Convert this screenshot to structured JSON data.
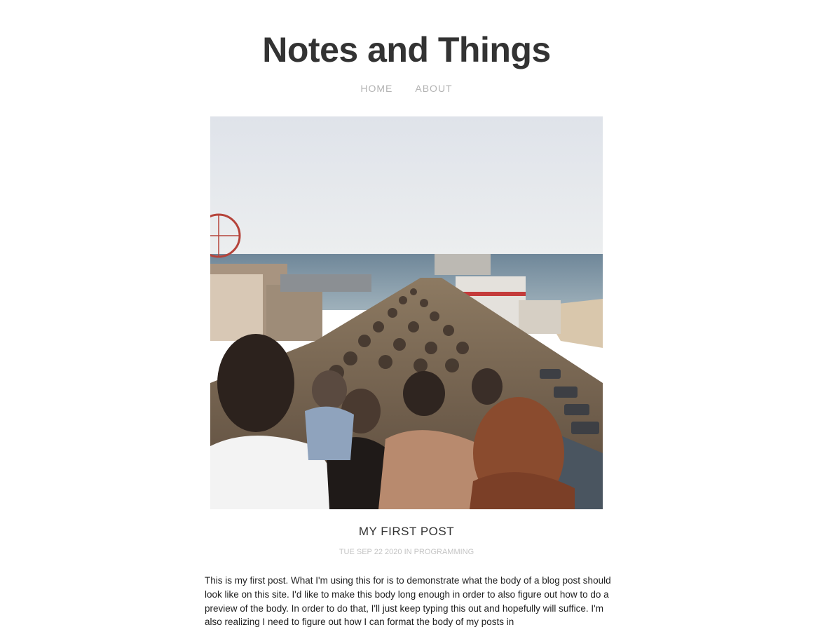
{
  "site": {
    "title": "Notes and Things"
  },
  "nav": {
    "items": [
      {
        "label": "HOME"
      },
      {
        "label": "ABOUT"
      }
    ]
  },
  "post": {
    "title": "MY FIRST POST",
    "date": "TUE SEP 22 2020",
    "meta_joiner": "IN",
    "category": "PROGRAMMING",
    "body": "This is my first post. What I'm using this for is to demonstrate what the body of a blog post should look like on this site. I'd like to make this body long enough in order to also figure out how to do a preview of the body. In order to do that, I'll just keep typing this out and hopefully will suffice. I'm also realizing I need to figure out how I can format the body of my posts in"
  },
  "colors": {
    "title": "#333333",
    "nav": "#b3b3b3",
    "meta": "#c4c4c4",
    "body": "#1e1e1e"
  }
}
